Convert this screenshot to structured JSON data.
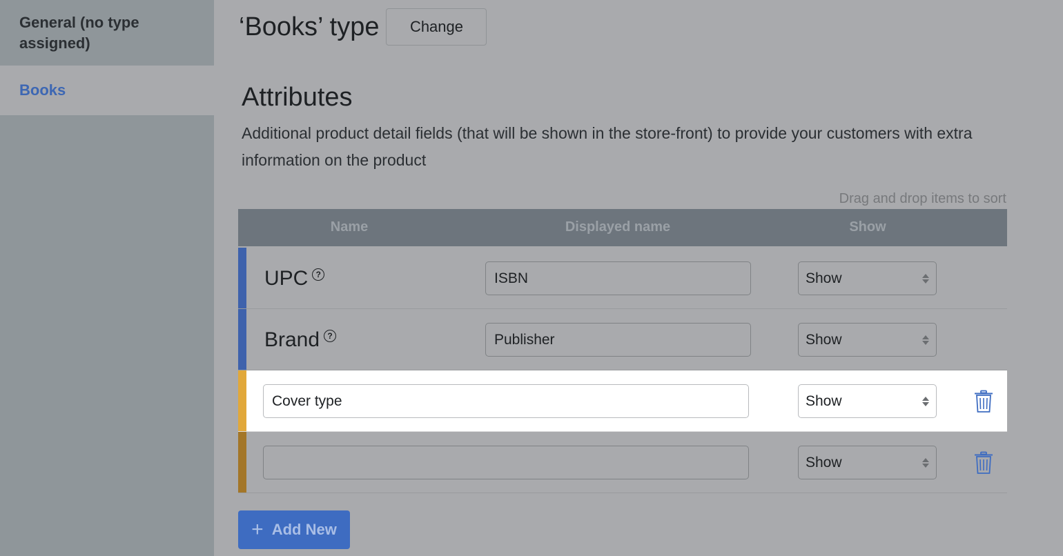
{
  "sidebar": {
    "items": [
      {
        "label": "General (no type assigned)"
      },
      {
        "label": "Books"
      }
    ]
  },
  "header": {
    "title": "‘Books’ type",
    "change_label": "Change"
  },
  "attributes": {
    "title": "Attributes",
    "description": "Additional product detail fields (that will be shown in the store-front) to provide your customers with extra information on the product",
    "sort_hint": "Drag and drop items to sort",
    "columns": {
      "name": "Name",
      "displayed_name": "Displayed name",
      "show": "Show"
    },
    "rows": [
      {
        "name": "UPC",
        "displayed_name": "ISBN",
        "show": "Show"
      },
      {
        "name": "Brand",
        "displayed_name": "Publisher",
        "show": "Show"
      },
      {
        "value": "Cover type",
        "show": "Show"
      },
      {
        "value": "",
        "show": "Show"
      }
    ],
    "add_label": "Add New"
  },
  "colors": {
    "accent": "#3e6cc1",
    "row_bar_builtin": "#3e62ac",
    "row_bar_custom_active": "#e1a83b",
    "row_bar_custom": "#a37628"
  },
  "icons": {
    "help": "question-circle-icon",
    "delete": "trash-icon",
    "add": "plus-icon"
  }
}
